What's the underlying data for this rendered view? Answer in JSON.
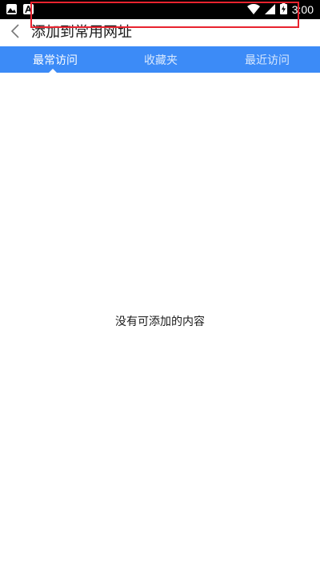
{
  "status_bar": {
    "time": "3:00",
    "left_icons": [
      "image-icon",
      "font-a-icon"
    ],
    "right_icons": [
      "wifi-icon",
      "signal-icon",
      "battery-charging-icon"
    ]
  },
  "header": {
    "back_icon": "chevron-left-icon",
    "title": "添加到常用网址"
  },
  "tabs": [
    {
      "label": "最常访问",
      "active": true
    },
    {
      "label": "收藏夹",
      "active": false
    },
    {
      "label": "最近访问",
      "active": false
    }
  ],
  "empty_state": {
    "message": "没有可添加的内容"
  },
  "colors": {
    "tab_bar": "#3c8bf7",
    "highlight_box": "#e8232f",
    "status_bar": "#000000"
  }
}
